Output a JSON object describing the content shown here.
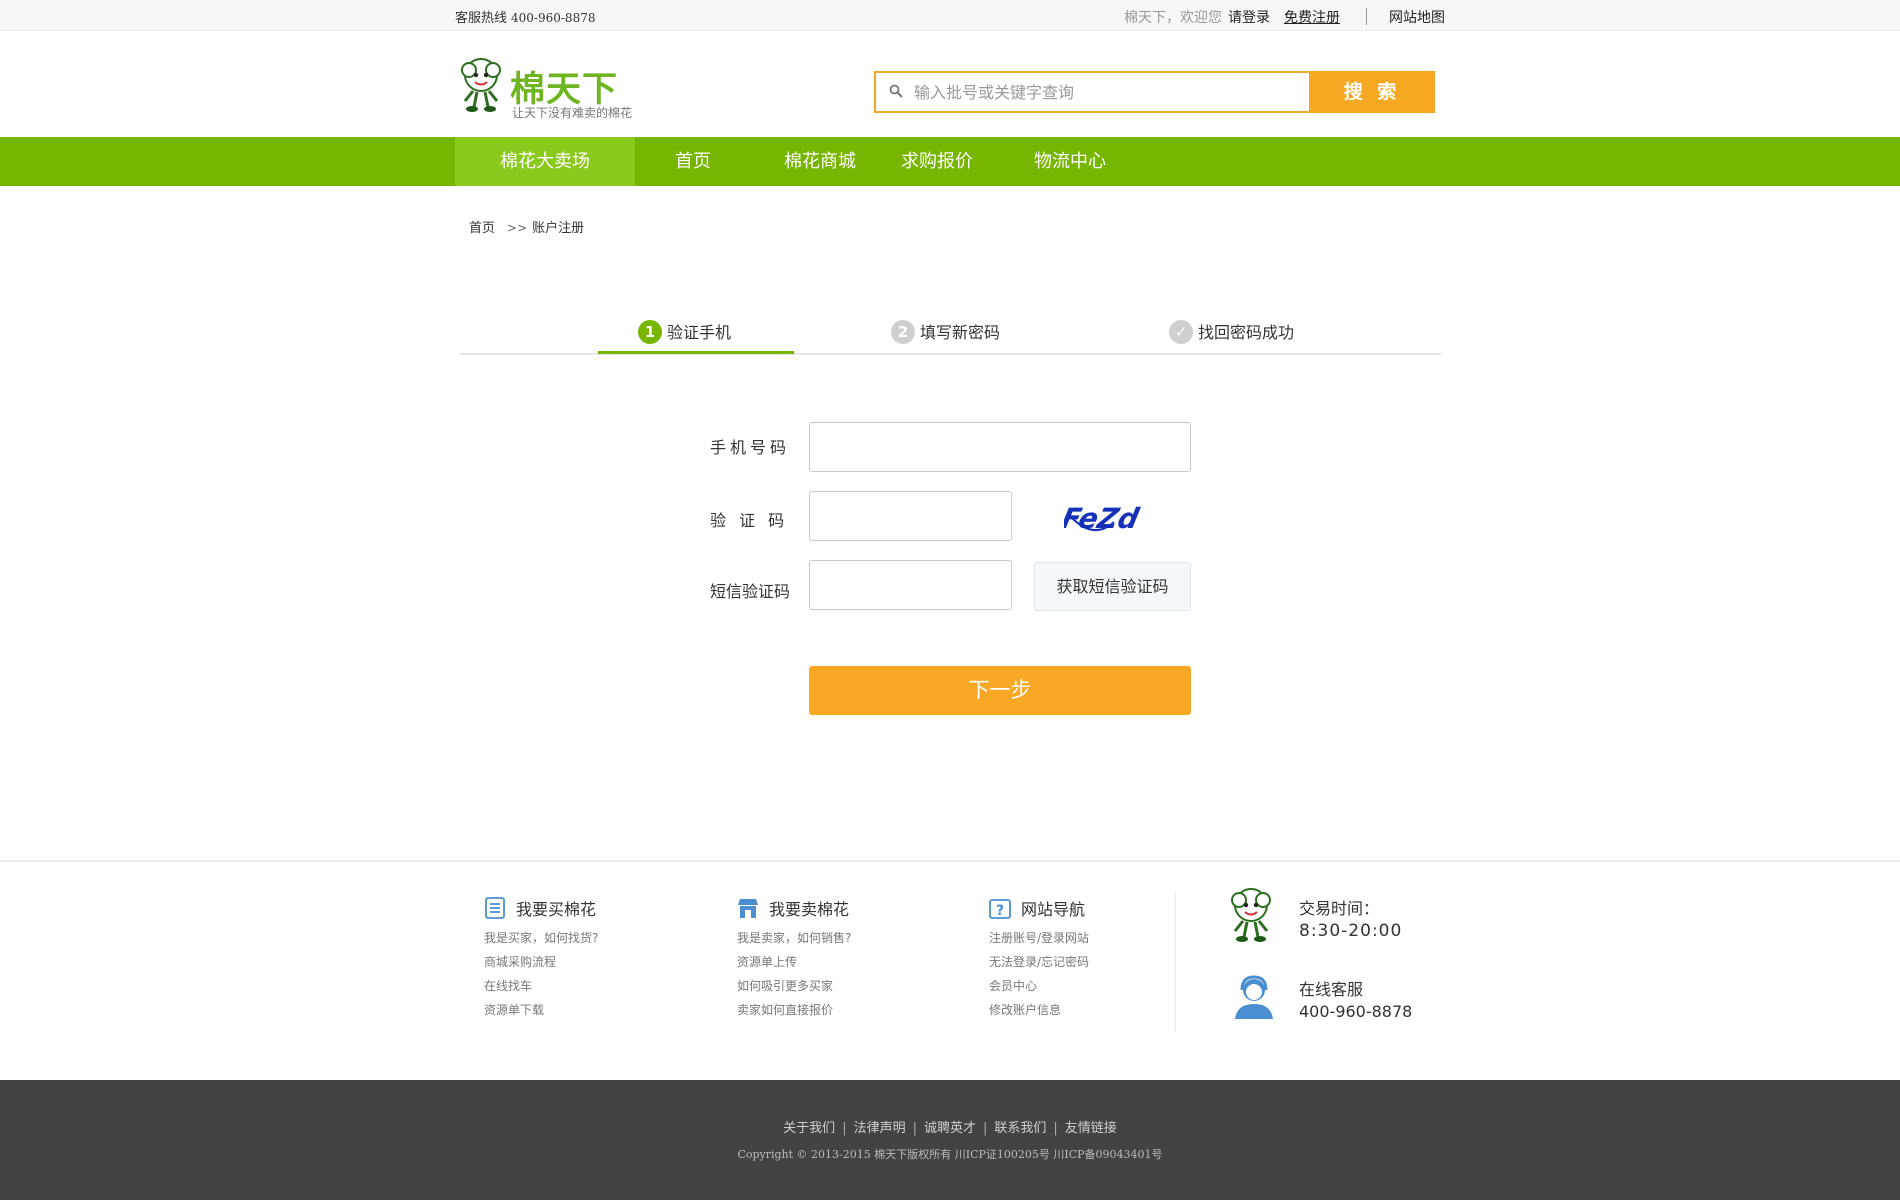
{
  "topbar": {
    "hotline_label": "客服热线",
    "hotline_number": "400-960-8878",
    "welcome": "棉天下，欢迎您",
    "login": "请登录",
    "register": "免费注册",
    "sitemap": "网站地图"
  },
  "header": {
    "logo_name": "棉天下",
    "logo_slogan": "让天下没有难卖的棉花",
    "search_placeholder": "输入批号或关键字查询",
    "search_button": "搜 索"
  },
  "nav": {
    "items": [
      {
        "label": "棉花大卖场",
        "active": true
      },
      {
        "label": "首页"
      },
      {
        "label": "棉花商城"
      },
      {
        "label": "求购报价"
      },
      {
        "label": "物流中心"
      }
    ]
  },
  "breadcrumb": {
    "home": "首页",
    "arrow": ">>",
    "current": "账户注册"
  },
  "steps": [
    {
      "num": "1",
      "label": "验证手机"
    },
    {
      "num": "2",
      "label": "填写新密码"
    },
    {
      "num": "✓",
      "label": "找回密码成功"
    }
  ],
  "form": {
    "phone_label": "手机号码",
    "captcha_label": "验 证 码",
    "captcha_text": "FeZd",
    "sms_label": "短信验证码",
    "sms_button": "获取短信验证码",
    "next_button": "下一步"
  },
  "footer": {
    "columns": [
      {
        "title": "我要买棉花",
        "icon": "list-icon",
        "links": [
          "我是买家，如何找货?",
          "商城采购流程",
          "在线找车",
          "资源单下载"
        ]
      },
      {
        "title": "我要卖棉花",
        "icon": "store-icon",
        "links": [
          "我是卖家，如何销售?",
          "资源单上传",
          "如何吸引更多买家",
          "卖家如何直接报价"
        ]
      },
      {
        "title": "网站导航",
        "icon": "help-icon",
        "links": [
          "注册账号/登录网站",
          "无法登录/忘记密码",
          "会员中心",
          "修改账户信息"
        ]
      }
    ],
    "trade_time_label": "交易时间：",
    "trade_time": "8:30-20:00",
    "service_label": "在线客服",
    "service_phone": "400-960-8878"
  },
  "bottom": {
    "links": [
      "关于我们",
      "法律声明",
      "诚聘英才",
      "联系我们",
      "友情链接"
    ],
    "copyright": "Copyright © 2013-2015 棉天下版权所有 川ICP证100205号 川ICP备09043401号"
  },
  "colors": {
    "brand_green": "#76b500",
    "accent_orange": "#f9a825"
  }
}
